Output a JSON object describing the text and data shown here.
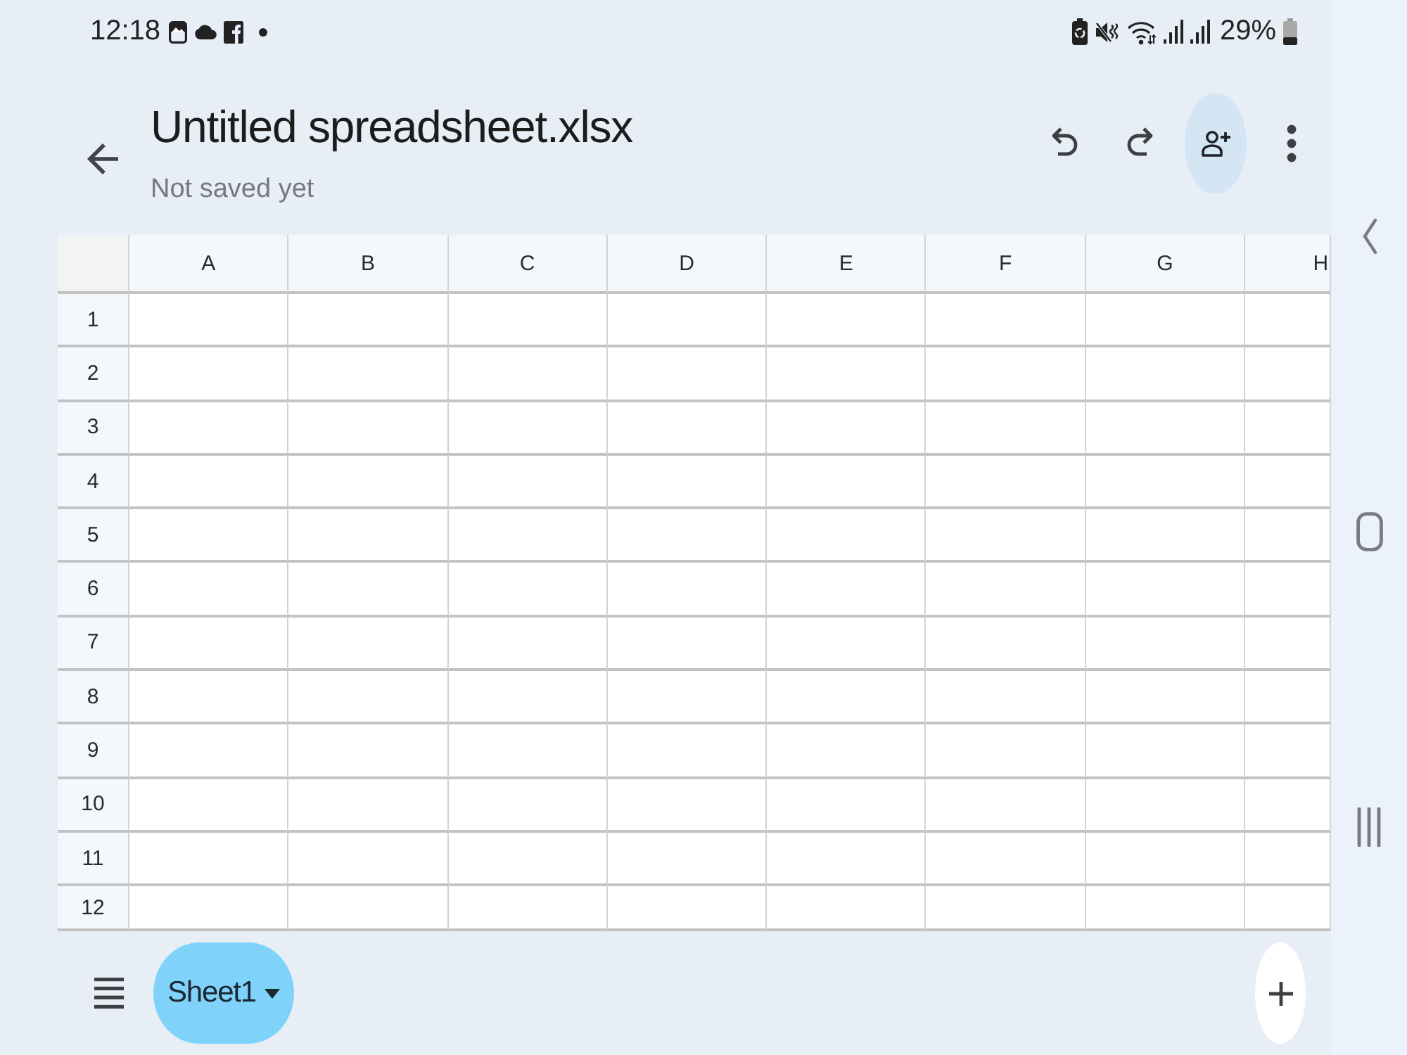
{
  "status_bar": {
    "time": "12:18",
    "battery_percent": "29%"
  },
  "header": {
    "title": "Untitled spreadsheet.xlsx",
    "subtitle": "Not saved yet"
  },
  "sheet": {
    "columns": [
      "A",
      "B",
      "C",
      "D",
      "E",
      "F",
      "G",
      "H"
    ],
    "rows": [
      "1",
      "2",
      "3",
      "4",
      "5",
      "6",
      "7",
      "8",
      "9",
      "10",
      "11",
      "12"
    ]
  },
  "sheet_tabs": [
    {
      "label": "Sheet1",
      "selected": true
    }
  ]
}
